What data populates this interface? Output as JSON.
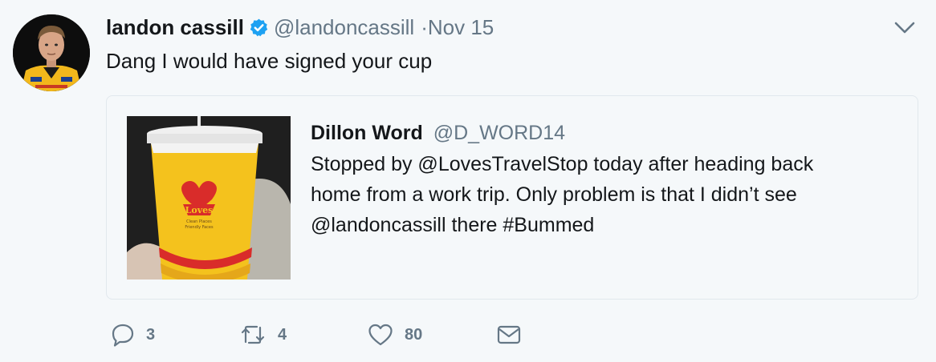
{
  "author": {
    "name": "landon cassill",
    "handle": "@landoncassill",
    "separator": "·",
    "date": "Nov 15",
    "verified": true
  },
  "tweet": {
    "text": "Dang I would have signed your cup"
  },
  "quoted": {
    "name": "Dillon Word",
    "handle": "@D_WORD14",
    "lines": [
      "Stopped by @LovesTravelStop today after heading back",
      "home from a work trip. Only problem is that I didn’t see",
      "@landoncassill there #Bummed"
    ],
    "image_text": {
      "brand": "Loves",
      "tagline_1": "Clean Places",
      "tagline_2": "Friendly Faces"
    }
  },
  "actions": {
    "reply_count": "3",
    "retweet_count": "4",
    "like_count": "80"
  },
  "icons": {
    "verified": "verified-badge-icon",
    "caret": "chevron-down-icon",
    "reply": "reply-icon",
    "retweet": "retweet-icon",
    "like": "heart-icon",
    "message": "envelope-icon"
  },
  "colors": {
    "background": "#f5f8fa",
    "primary_text": "#14171a",
    "secondary_text": "#657786",
    "verified_blue": "#1da1f2",
    "border": "#e1e8ed"
  }
}
